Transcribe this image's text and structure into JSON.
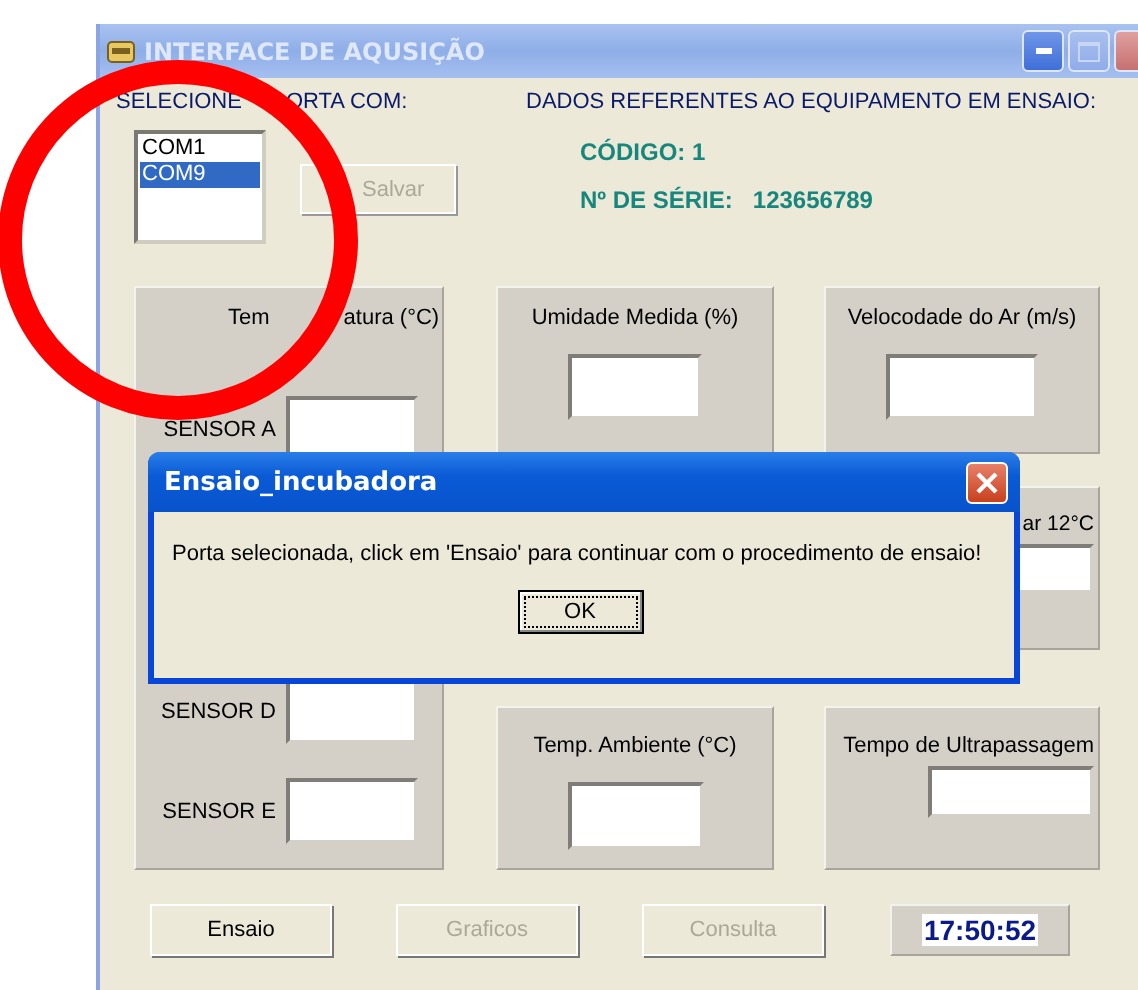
{
  "window": {
    "title": "INTERFACE DE AQUSIÇÃO"
  },
  "port_label_parts": [
    "SELECIONE",
    "ORTA COM:"
  ],
  "equipment_label": "DADOS REFERENTES AO EQUIPAMENTO EM ENSAIO:",
  "port_list": [
    {
      "label": "COM1",
      "selected": false
    },
    {
      "label": "COM9",
      "selected": true
    }
  ],
  "save_button": {
    "label": "Salvar",
    "disabled": true
  },
  "code": "CÓDIGO: 1",
  "serial": {
    "label": "Nº DE SÉRIE:",
    "value": "123656789"
  },
  "temperature_panel": {
    "title_parts": [
      "Tem",
      "atura (°C)"
    ],
    "sensors": [
      {
        "label": "SENSOR A"
      },
      {
        "label": "SENSOR D"
      },
      {
        "label": "SENSOR E"
      }
    ]
  },
  "humidity_panel": {
    "title": "Umidade Medida (%)"
  },
  "air_speed_panel": {
    "title": "Velocodade do Ar (m/s)"
  },
  "partial_panel": {
    "title": "ar 12°C"
  },
  "ambient_panel": {
    "title": "Temp.  Ambiente (°C)"
  },
  "overshoot_panel": {
    "title": "Tempo de Ultrapassagem"
  },
  "buttons": [
    {
      "label": "Ensaio",
      "disabled": false
    },
    {
      "label": "Graficos",
      "disabled": true
    },
    {
      "label": "Consulta",
      "disabled": true
    }
  ],
  "clock": "17:50:52",
  "dialog": {
    "title": "Ensaio_incubadora",
    "message": "Porta selecionada, click em 'Ensaio' para continuar com o procedimento de ensaio!",
    "button": "OK"
  }
}
